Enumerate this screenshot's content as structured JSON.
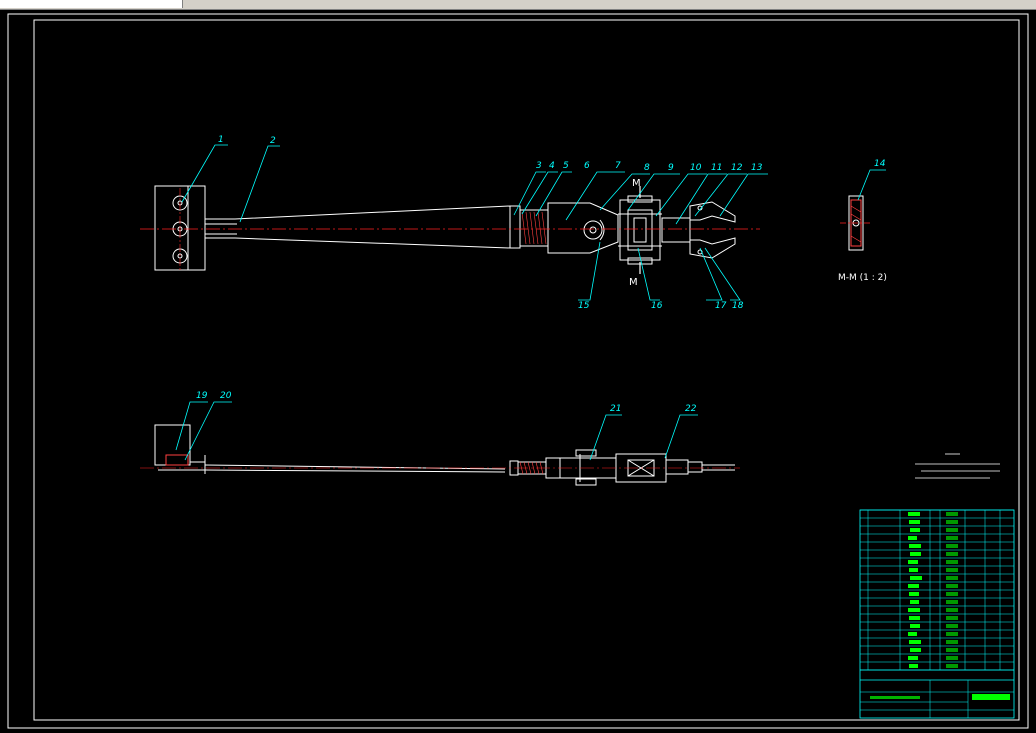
{
  "view_label": "M-M (1 : 2)",
  "section_marker": "M",
  "callouts": [
    "1",
    "2",
    "3",
    "4",
    "5",
    "6",
    "7",
    "8",
    "9",
    "10",
    "11",
    "12",
    "13",
    "14",
    "15",
    "16",
    "17",
    "18",
    "19",
    "20",
    "21",
    "22"
  ],
  "colors": {
    "background": "#000000",
    "outline": "#ffffff",
    "centerline": "#ff2020",
    "leader": "#00ffff",
    "hatch": "#ff4040",
    "title_text": "#00ff00"
  }
}
